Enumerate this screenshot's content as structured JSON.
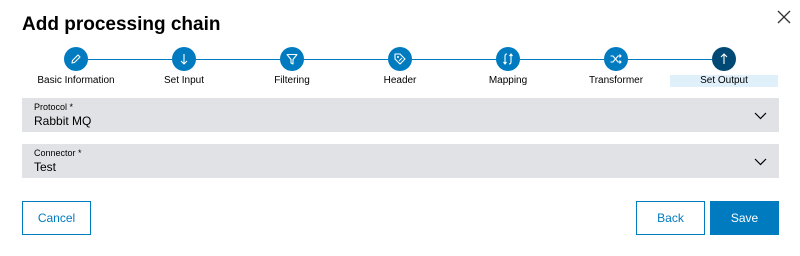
{
  "dialog": {
    "title": "Add processing chain",
    "close_icon": "close-icon"
  },
  "stepper": {
    "accent": "#007bc0",
    "active_color": "#004975",
    "steps": [
      {
        "label": "Basic Information",
        "icon": "pencil-icon"
      },
      {
        "label": "Set Input",
        "icon": "arrow-down-icon"
      },
      {
        "label": "Filtering",
        "icon": "filter-icon"
      },
      {
        "label": "Header",
        "icon": "header-tag-icon"
      },
      {
        "label": "Mapping",
        "icon": "mapping-arrows-icon"
      },
      {
        "label": "Transformer",
        "icon": "shuffle-icon"
      },
      {
        "label": "Set Output",
        "icon": "arrow-up-icon"
      }
    ],
    "active_step": "Set Output"
  },
  "form": {
    "protocol": {
      "label": "Protocol *",
      "value": "Rabbit MQ"
    },
    "connector": {
      "label": "Connector *",
      "value": "Test"
    }
  },
  "buttons": {
    "cancel": "Cancel",
    "back": "Back",
    "save": "Save"
  }
}
